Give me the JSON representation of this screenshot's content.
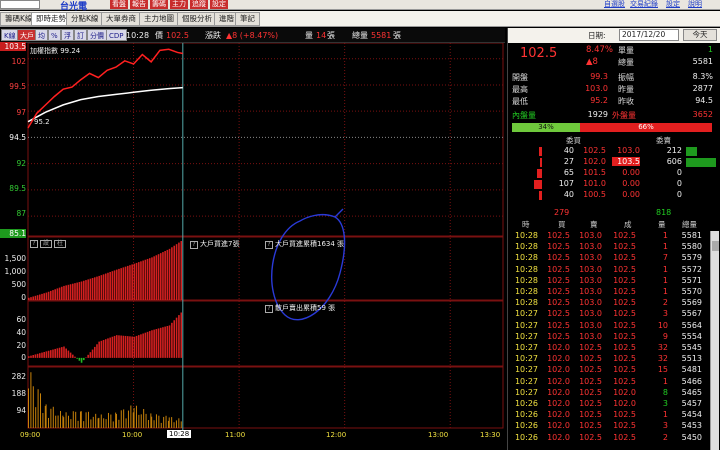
{
  "topbar": {
    "stock_name": "台光電",
    "buttons": [
      "看盤",
      "報告",
      "籌碼",
      "主力",
      "追蹤",
      "設定"
    ],
    "right_links": [
      "自選股",
      "交易紀錄",
      "設定",
      "說明"
    ]
  },
  "tabs": [
    "籌碼K線",
    "即時走勢",
    "分點K線",
    "大單券商",
    "主力地圖",
    "個股分析",
    "進階",
    "筆記"
  ],
  "active_tab": 1,
  "quotebar": {
    "buttons": [
      "K線",
      "大戶",
      "均",
      "%",
      "浮",
      "訂",
      "分價",
      "CDP"
    ],
    "active_button": 1,
    "time": "10:28",
    "price_label": "價",
    "price": "102.5",
    "change_label": "漲跌",
    "change": "▲8 (+8.47%)",
    "vol_label": "量",
    "vol": "14",
    "vol_unit": "張",
    "total_label": "總量",
    "total": "5581",
    "total_unit": "張"
  },
  "chart": {
    "legend": "加權指數 99.24",
    "y_ticks": [
      "103.5",
      "102",
      "99.5",
      "97",
      "94.5",
      "92",
      "89.5",
      "87",
      "85.1"
    ],
    "low_marker": "95.2",
    "high_marker": "103.5",
    "big_order_panel": {
      "buttons": [
        "?",
        "設",
        "柱"
      ],
      "y_ticks": [
        "1,500",
        "1,000",
        "500",
        "0"
      ],
      "label_mid": "大戶買進7張",
      "label_right": "大戶買進累積1634 張"
    },
    "retail_panel": {
      "y_ticks": [
        "60",
        "40",
        "20",
        "0"
      ],
      "label": "散戶賣出累積59 張"
    },
    "volume_panel": {
      "y_ticks": [
        "282",
        "188",
        "94"
      ]
    },
    "x_ticks": [
      "09:00",
      "10:00",
      "10:28",
      "11:00",
      "12:00",
      "13:00",
      "13:30"
    ],
    "colors": {
      "price_line": "#ff2020",
      "index_line": "#ffffff",
      "bar_red": "#d42020",
      "bar_green": "#22bb22",
      "vol_bar": "#c8820a",
      "grid": "#7a1111"
    }
  },
  "chart_data": [
    {
      "type": "line",
      "title": "",
      "ylim": [
        85.1,
        103.5
      ],
      "series": [
        {
          "name": "",
          "x": [
            "09:00",
            "09:05",
            "09:10",
            "09:15",
            "09:20",
            "09:25",
            "09:30",
            "09:35",
            "09:40",
            "09:45",
            "09:50",
            "09:55",
            "10:00",
            "10:05",
            "10:10",
            "10:15",
            "10:20",
            "10:25",
            "10:28"
          ],
          "values": [
            95.4,
            96.8,
            97.6,
            98.4,
            99.1,
            99.3,
            100.0,
            100.6,
            100.2,
            100.9,
            101.2,
            101.8,
            101.5,
            102.4,
            101.7,
            102.8,
            102.9,
            102.6,
            102.5
          ]
        },
        {
          "name": "加權指數",
          "x": [
            "09:00",
            "09:10",
            "09:20",
            "09:30",
            "09:40",
            "09:50",
            "10:00",
            "10:10",
            "10:20",
            "10:28"
          ],
          "values": [
            96.0,
            96.9,
            97.6,
            98.1,
            98.4,
            98.6,
            98.8,
            99.0,
            99.15,
            99.24
          ]
        }
      ]
    },
    {
      "type": "bar",
      "title": "",
      "ylim": [
        0,
        1700
      ],
      "x": [
        "09:00",
        "09:10",
        "09:20",
        "09:30",
        "09:40",
        "09:50",
        "10:00",
        "10:10",
        "10:20",
        "10:28"
      ],
      "values": [
        60,
        200,
        380,
        500,
        650,
        820,
        980,
        1150,
        1380,
        1634
      ]
    },
    {
      "type": "bar",
      "title": "",
      "ylim": [
        -10,
        70
      ],
      "x": [
        "09:00",
        "09:10",
        "09:20",
        "09:30",
        "09:40",
        "09:50",
        "10:00",
        "10:10",
        "10:20",
        "10:28"
      ],
      "values": [
        2,
        8,
        14,
        -6,
        20,
        28,
        26,
        34,
        40,
        59
      ]
    },
    {
      "type": "bar",
      "title": "",
      "ylim": [
        0,
        282
      ],
      "x": [
        "09:00",
        "09:10",
        "09:20",
        "09:30",
        "09:40",
        "09:50",
        "10:00",
        "10:10",
        "10:20",
        "10:28"
      ],
      "values": [
        282,
        120,
        70,
        90,
        60,
        80,
        110,
        70,
        55,
        40
      ]
    }
  ],
  "right": {
    "date_label": "日期:",
    "date_value": "2017/12/20",
    "today_button": "今天",
    "price": "102.5",
    "pct": "8.47%",
    "chg": "▲8",
    "single_label": "單量",
    "single_val": "1",
    "total_label": "總量",
    "total_val": "5581",
    "stats": [
      {
        "label": "開盤",
        "val": "99.3",
        "label2": "振幅",
        "val2": "8.3%"
      },
      {
        "label": "最高",
        "val": "103.0",
        "label2": "昨量",
        "val2": "2877"
      },
      {
        "label": "最低",
        "val": "95.2",
        "label2": "昨收",
        "val2": "94.5"
      }
    ],
    "inner_label": "內盤量",
    "inner_val": "1929",
    "outer_label": "外盤量",
    "outer_val": "3652",
    "ratio_buy": "34%",
    "ratio_sell": "66%",
    "book_hdr_bid": "委買",
    "book_hdr_ask": "委賣",
    "book": [
      {
        "bq": "40",
        "bp": "102.5",
        "ap": "103.0",
        "aq": "212"
      },
      {
        "bq": "27",
        "bp": "102.0",
        "ap": "103.5",
        "aq": "606"
      },
      {
        "bq": "65",
        "bp": "101.5",
        "ap": "0.00",
        "aq": "0"
      },
      {
        "bq": "107",
        "bp": "101.0",
        "ap": "0.00",
        "aq": "0"
      },
      {
        "bq": "40",
        "bp": "100.5",
        "ap": "0.00",
        "aq": "0"
      }
    ],
    "book_total_bid": "279",
    "book_total_ask": "818",
    "trade_hdr": [
      "時",
      "買",
      "賣",
      "成",
      "量",
      "總量"
    ],
    "trades": [
      {
        "t": "10:28",
        "b": "102.5",
        "s": "103.0",
        "p": "102.5",
        "q": "1",
        "tot": "5581"
      },
      {
        "t": "10:28",
        "b": "102.5",
        "s": "103.0",
        "p": "102.5",
        "q": "1",
        "tot": "5580"
      },
      {
        "t": "10:28",
        "b": "102.5",
        "s": "103.0",
        "p": "102.5",
        "q": "7",
        "tot": "5579"
      },
      {
        "t": "10:28",
        "b": "102.5",
        "s": "103.0",
        "p": "102.5",
        "q": "1",
        "tot": "5572"
      },
      {
        "t": "10:28",
        "b": "102.5",
        "s": "103.0",
        "p": "102.5",
        "q": "1",
        "tot": "5571"
      },
      {
        "t": "10:28",
        "b": "102.5",
        "s": "103.0",
        "p": "102.5",
        "q": "1",
        "tot": "5570"
      },
      {
        "t": "10:28",
        "b": "102.5",
        "s": "103.0",
        "p": "102.5",
        "q": "2",
        "tot": "5569"
      },
      {
        "t": "10:27",
        "b": "102.5",
        "s": "103.0",
        "p": "102.5",
        "q": "3",
        "tot": "5567"
      },
      {
        "t": "10:27",
        "b": "102.5",
        "s": "103.0",
        "p": "102.5",
        "q": "10",
        "tot": "5564"
      },
      {
        "t": "10:27",
        "b": "102.5",
        "s": "103.0",
        "p": "102.5",
        "q": "9",
        "tot": "5554"
      },
      {
        "t": "10:27",
        "b": "102.0",
        "s": "102.5",
        "p": "102.5",
        "q": "32",
        "tot": "5545"
      },
      {
        "t": "10:27",
        "b": "102.0",
        "s": "102.5",
        "p": "102.5",
        "q": "32",
        "tot": "5513"
      },
      {
        "t": "10:27",
        "b": "102.0",
        "s": "102.5",
        "p": "102.5",
        "q": "15",
        "tot": "5481"
      },
      {
        "t": "10:27",
        "b": "102.0",
        "s": "102.5",
        "p": "102.5",
        "q": "1",
        "tot": "5466"
      },
      {
        "t": "10:27",
        "b": "102.0",
        "s": "102.5",
        "p": "102.0",
        "q": "8",
        "tot": "5465"
      },
      {
        "t": "10:26",
        "b": "102.0",
        "s": "102.5",
        "p": "102.0",
        "q": "3",
        "tot": "5457"
      },
      {
        "t": "10:26",
        "b": "102.0",
        "s": "102.5",
        "p": "102.5",
        "q": "1",
        "tot": "5454"
      },
      {
        "t": "10:26",
        "b": "102.0",
        "s": "102.5",
        "p": "102.5",
        "q": "3",
        "tot": "5453"
      },
      {
        "t": "10:26",
        "b": "102.0",
        "s": "102.5",
        "p": "102.5",
        "q": "2",
        "tot": "5450"
      }
    ]
  }
}
